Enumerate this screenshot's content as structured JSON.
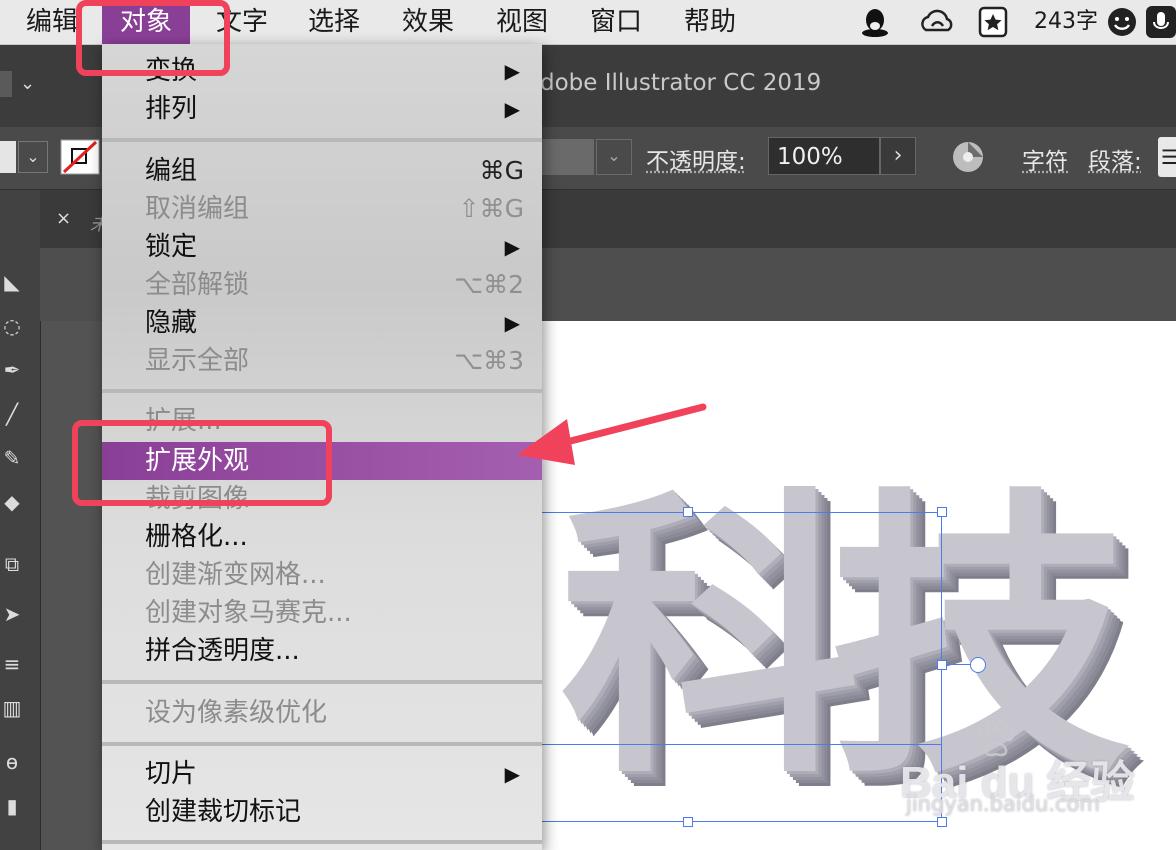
{
  "menubar": {
    "items": [
      "编辑",
      "对象",
      "文字",
      "选择",
      "效果",
      "视图",
      "窗口",
      "帮助"
    ],
    "word_count": "243字"
  },
  "app": {
    "title": "dobe Illustrator CC 2019",
    "opacity_label": "不透明度:",
    "opacity_value": "100%",
    "char_label": "字符",
    "para_label": "段落:",
    "tab_close": "×",
    "tab_name": "未"
  },
  "menu": {
    "items": [
      {
        "label": "变换",
        "shortcut": "",
        "submenu": "▶",
        "disabled": false
      },
      {
        "label": "排列",
        "shortcut": "",
        "submenu": "▶",
        "disabled": false
      },
      {
        "label": "编组",
        "shortcut": "⌘G",
        "submenu": "",
        "disabled": false
      },
      {
        "label": "取消编组",
        "shortcut": "⇧⌘G",
        "submenu": "",
        "disabled": true
      },
      {
        "label": "锁定",
        "shortcut": "",
        "submenu": "▶",
        "disabled": false
      },
      {
        "label": "全部解锁",
        "shortcut": "⌥⌘2",
        "submenu": "",
        "disabled": true
      },
      {
        "label": "隐藏",
        "shortcut": "",
        "submenu": "▶",
        "disabled": false
      },
      {
        "label": "显示全部",
        "shortcut": "⌥⌘3",
        "submenu": "",
        "disabled": true
      },
      {
        "label": "扩展...",
        "shortcut": "",
        "submenu": "",
        "disabled": true
      },
      {
        "label": "扩展外观",
        "shortcut": "",
        "submenu": "",
        "disabled": false
      },
      {
        "label": "裁剪图像",
        "shortcut": "",
        "submenu": "",
        "disabled": true
      },
      {
        "label": "栅格化...",
        "shortcut": "",
        "submenu": "",
        "disabled": false
      },
      {
        "label": "创建渐变网格...",
        "shortcut": "",
        "submenu": "",
        "disabled": true
      },
      {
        "label": "创建对象马赛克...",
        "shortcut": "",
        "submenu": "",
        "disabled": true
      },
      {
        "label": "拼合透明度...",
        "shortcut": "",
        "submenu": "",
        "disabled": false
      },
      {
        "label": "设为像素级优化",
        "shortcut": "",
        "submenu": "",
        "disabled": true
      },
      {
        "label": "切片",
        "shortcut": "",
        "submenu": "▶",
        "disabled": false
      },
      {
        "label": "创建裁切标记",
        "shortcut": "",
        "submenu": "",
        "disabled": false
      }
    ]
  },
  "artwork": {
    "text": "科技"
  },
  "watermark": {
    "main": "Bai du 经验",
    "sub": "jingyan.baidu.com"
  },
  "colors": {
    "accent": "#8a3f96",
    "annotation": "#f0425a",
    "selection": "#4b7bec"
  }
}
